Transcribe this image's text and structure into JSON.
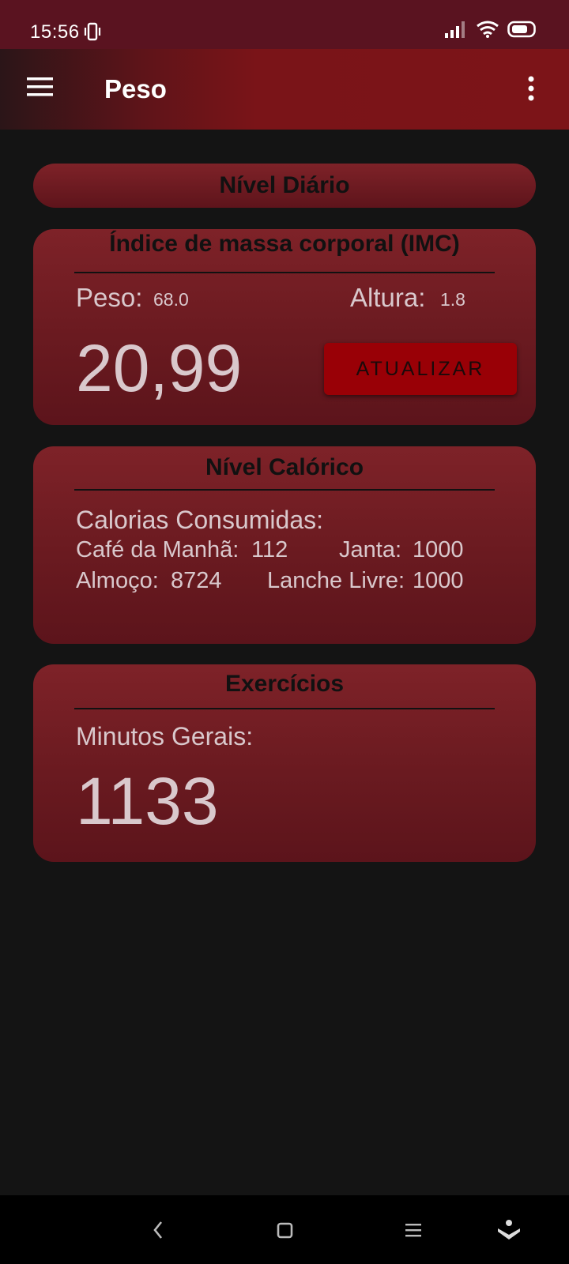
{
  "status_bar": {
    "time": "15:56",
    "icons": [
      "vibrate-icon",
      "signal-icon",
      "wifi-icon",
      "battery-icon"
    ]
  },
  "app_bar": {
    "title": "Peso",
    "icons": [
      "menu-icon",
      "more-vert-icon"
    ]
  },
  "daily": {
    "title": "Nível Diário"
  },
  "imc": {
    "title": "Índice de massa corporal (IMC)",
    "weight_label": "Peso:",
    "weight_value": "68.0",
    "height_label": "Altura:",
    "height_value": "1.8",
    "imc_value": "20,99",
    "update_button": "ATUALIZAR"
  },
  "calories": {
    "title": "Nível Calórico",
    "consumed_label": "Calorias Consumidas:",
    "breakfast_label": "Café da Manhã:",
    "breakfast_value": "112",
    "dinner_label": "Janta:",
    "dinner_value": "1000",
    "lunch_label": "Almoço:",
    "lunch_value": "8724",
    "free_snack_label": "Lanche Livre:",
    "free_snack_value": "1000"
  },
  "exercises": {
    "title": "Exercícios",
    "minutes_label": "Minutos Gerais:",
    "minutes_value": "1133"
  },
  "nav_bar": {
    "icons": [
      "back-icon",
      "home-icon",
      "recents-icon",
      "assistant-icon"
    ]
  },
  "colors": {
    "background": "#141414",
    "status_bar": "#5a1320",
    "app_bar": "#7c1418",
    "card": "#6a1a20",
    "button": "#990006",
    "text_light": "#d9c8cc"
  }
}
